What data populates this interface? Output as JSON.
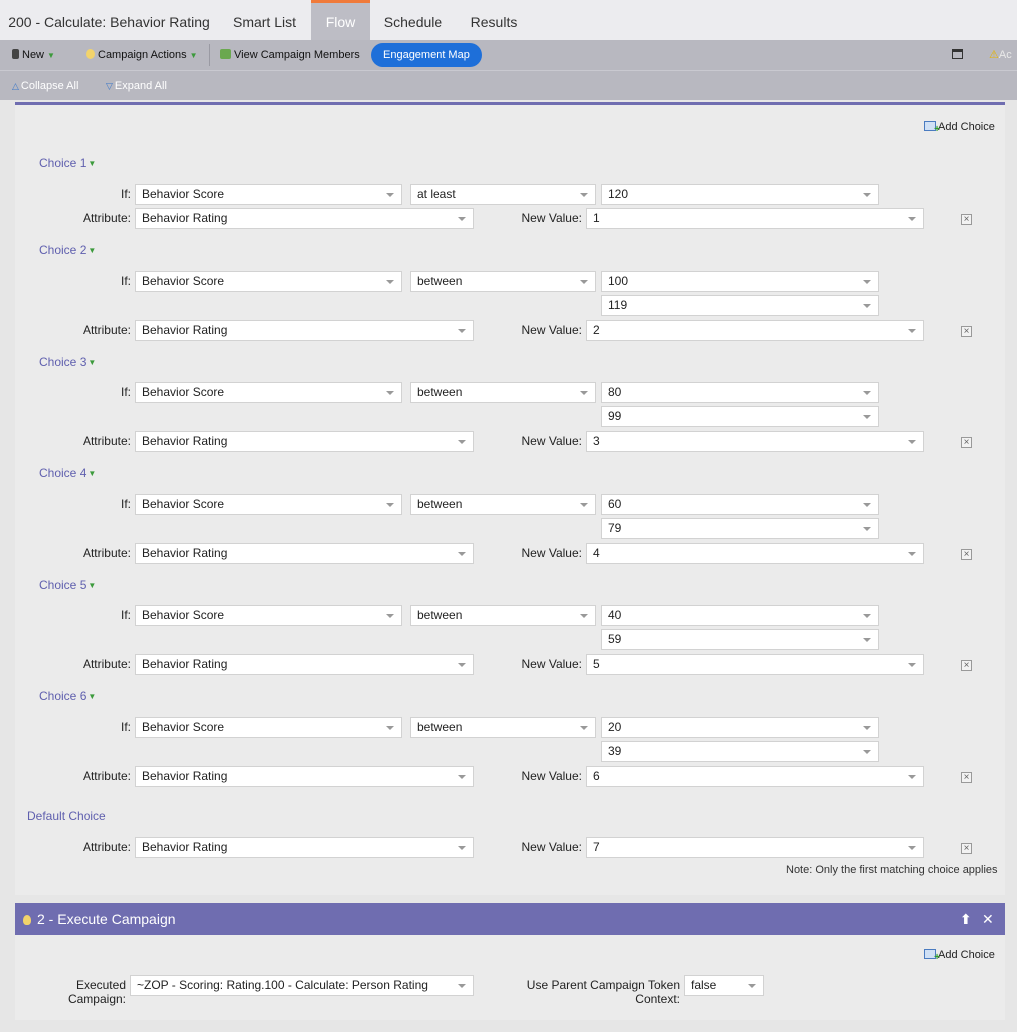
{
  "tabs": [
    {
      "label": "200 - Calculate: Behavior Rating",
      "active": false
    },
    {
      "label": "Smart List",
      "active": false
    },
    {
      "label": "Flow",
      "active": true
    },
    {
      "label": "Schedule",
      "active": false
    },
    {
      "label": "Results",
      "active": false
    }
  ],
  "toolbar": {
    "new_label": "New",
    "campaign_actions_label": "Campaign Actions",
    "view_members_label": "View Campaign Members",
    "engagement_map_label": "Engagement Map",
    "truncated_right_label": "Ac"
  },
  "subbar": {
    "collapse_all": "Collapse All",
    "expand_all": "Expand All"
  },
  "step1": {
    "add_choice_label": "Add Choice",
    "if_label": "If:",
    "attribute_label": "Attribute:",
    "new_value_label": "New Value:",
    "choices": [
      {
        "title": "Choice 1",
        "field": "Behavior Score",
        "operator": "at least",
        "value1": "120",
        "value2": null,
        "attribute": "Behavior Rating",
        "new_value": "1"
      },
      {
        "title": "Choice 2",
        "field": "Behavior Score",
        "operator": "between",
        "value1": "100",
        "value2": "119",
        "attribute": "Behavior Rating",
        "new_value": "2"
      },
      {
        "title": "Choice 3",
        "field": "Behavior Score",
        "operator": "between",
        "value1": "80",
        "value2": "99",
        "attribute": "Behavior Rating",
        "new_value": "3"
      },
      {
        "title": "Choice 4",
        "field": "Behavior Score",
        "operator": "between",
        "value1": "60",
        "value2": "79",
        "attribute": "Behavior Rating",
        "new_value": "4"
      },
      {
        "title": "Choice 5",
        "field": "Behavior Score",
        "operator": "between",
        "value1": "40",
        "value2": "59",
        "attribute": "Behavior Rating",
        "new_value": "5"
      },
      {
        "title": "Choice 6",
        "field": "Behavior Score",
        "operator": "between",
        "value1": "20",
        "value2": "39",
        "attribute": "Behavior Rating",
        "new_value": "6"
      }
    ],
    "default_choice": {
      "title": "Default Choice",
      "attribute": "Behavior Rating",
      "new_value": "7"
    },
    "note": "Note: Only the first matching choice applies"
  },
  "step2": {
    "title": "2 - Execute Campaign",
    "add_choice_label": "Add Choice",
    "executed_campaign_label": "Executed Campaign:",
    "executed_campaign_value": "~ZOP - Scoring: Rating.100 - Calculate: Person Rating",
    "token_context_label": "Use Parent Campaign Token Context:",
    "token_context_value": "false"
  }
}
